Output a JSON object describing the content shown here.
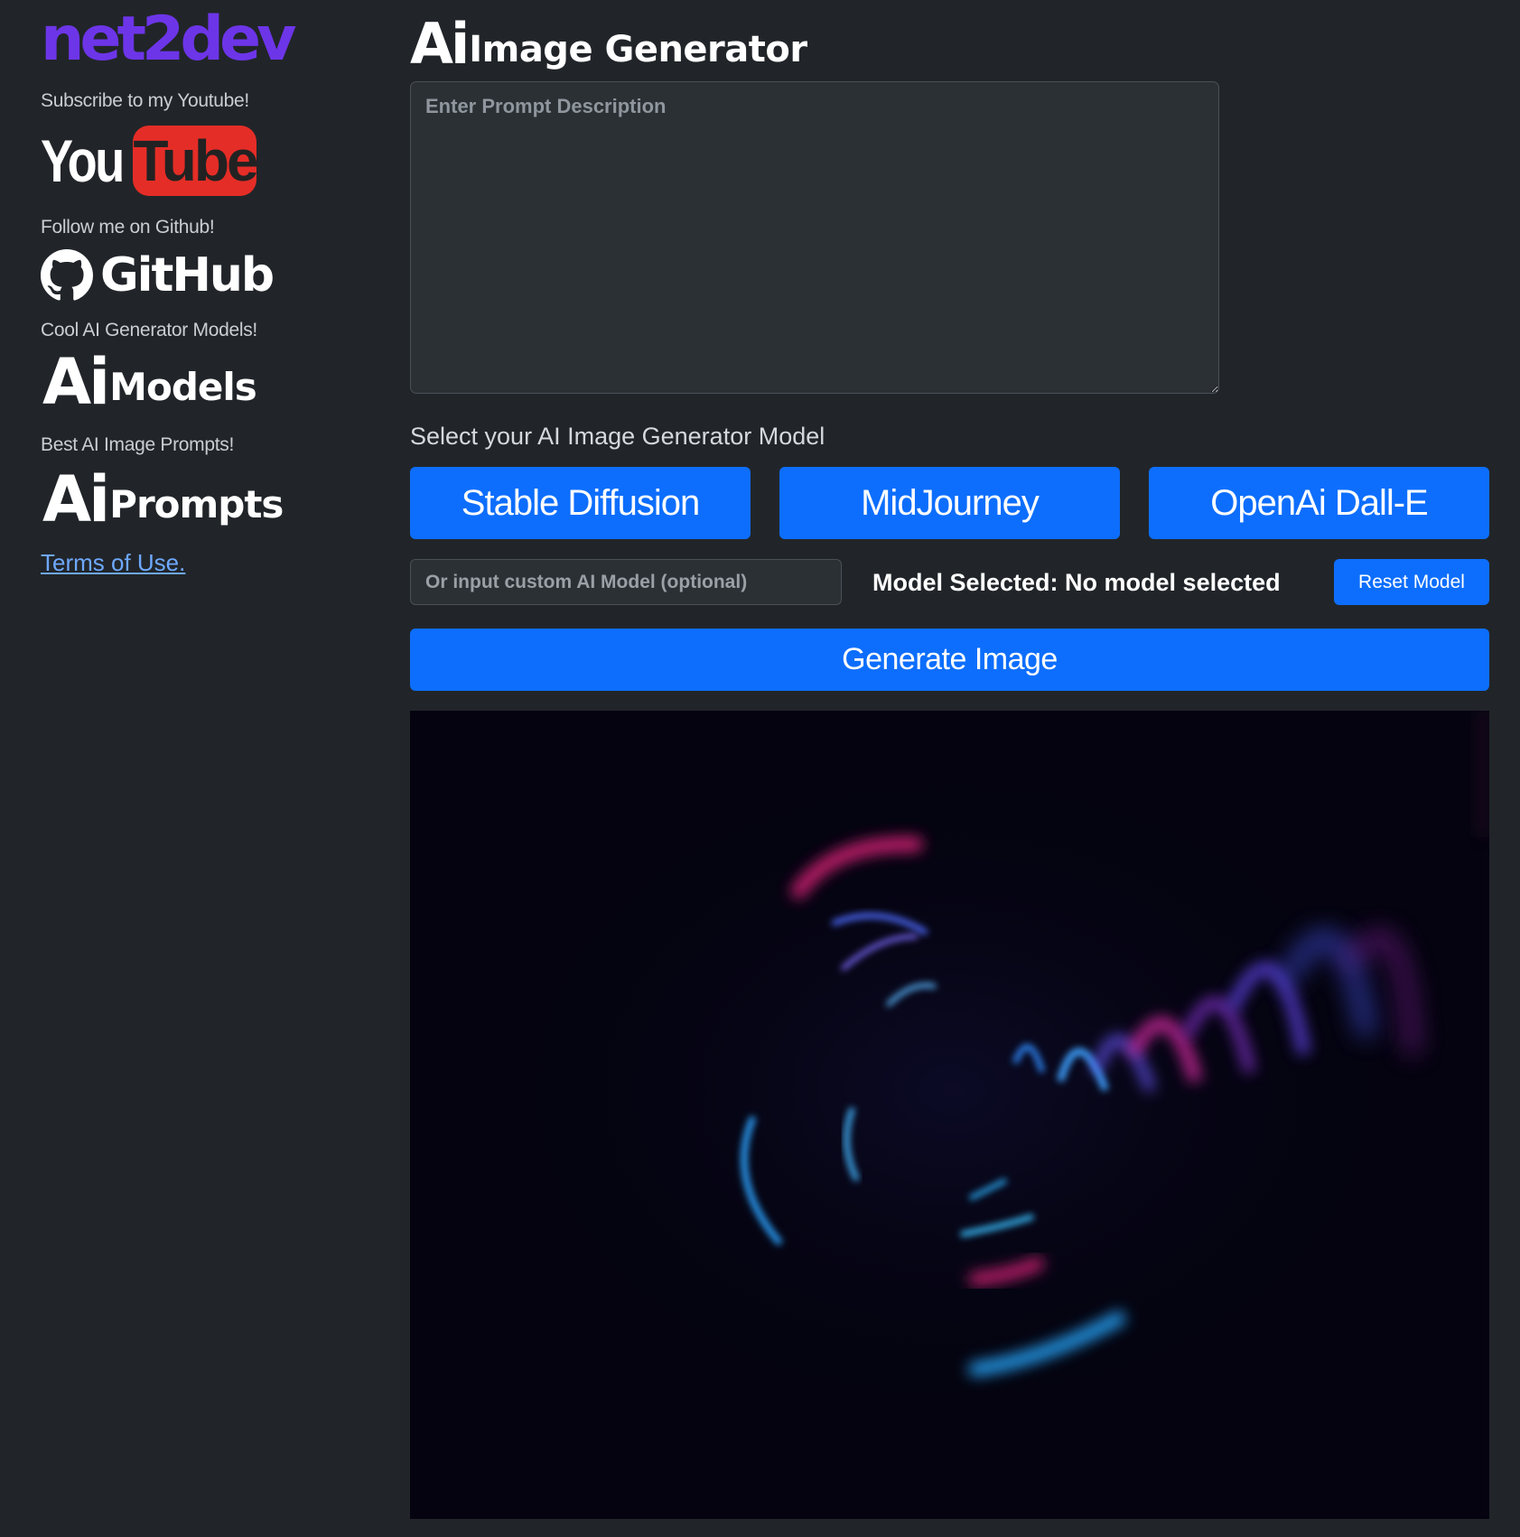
{
  "sidebar": {
    "brand": "net2dev",
    "youtube_caption": "Subscribe to my Youtube!",
    "youtube_logo": {
      "you": "You",
      "tube": "Tube"
    },
    "github_caption": "Follow me on Github!",
    "github_logo_text": "GitHub",
    "models_caption": "Cool AI Generator Models!",
    "models_logo": {
      "ai": "Ai",
      "rest": "Models"
    },
    "prompts_caption": "Best AI Image Prompts!",
    "prompts_logo": {
      "ai": "Ai",
      "rest": "Prompts"
    },
    "terms_link": "Terms of Use."
  },
  "main": {
    "title": {
      "ai": "Ai",
      "rest": "Image Generator"
    },
    "prompt": {
      "placeholder": "Enter Prompt Description",
      "value": ""
    },
    "select_label": "Select your AI Image Generator Model",
    "models": [
      {
        "label": "Stable Diffusion"
      },
      {
        "label": "MidJourney"
      },
      {
        "label": "OpenAi Dall-E"
      }
    ],
    "custom_model": {
      "placeholder": "Or input custom AI Model (optional)",
      "value": ""
    },
    "model_selected_text": "Model Selected: No model selected",
    "reset_button": "Reset Model",
    "generate_button": "Generate Image"
  },
  "colors": {
    "background": "#212529",
    "accent_blue": "#0d6efd",
    "brand_purple": "#6d35e8",
    "youtube_red": "#e52d27",
    "link_blue": "#6ea8fe"
  },
  "icons": [
    "github-octocat-icon"
  ]
}
